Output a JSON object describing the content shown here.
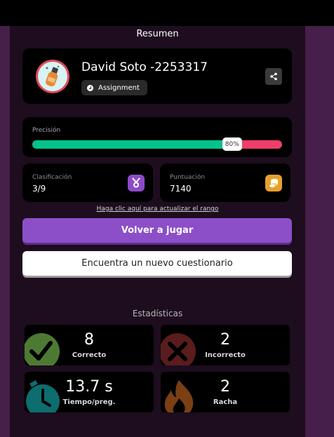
{
  "summary": {
    "title": "Resumen"
  },
  "user": {
    "name": "David Soto -2253317",
    "badge_label": "Assignment"
  },
  "precision": {
    "label": "Precisión",
    "value_text": "80%",
    "fraction": 0.8
  },
  "ranking": {
    "label": "Clasificación",
    "value": "3/9"
  },
  "score": {
    "label": "Puntuación",
    "value": "7140"
  },
  "rank_link": "Haga clic aquí para actualizar el rango",
  "buttons": {
    "play_again": "Volver a jugar",
    "find_quiz": "Encuentra un nuevo cuestionario"
  },
  "stats": {
    "title": "Estadísticas",
    "correct": {
      "value": "8",
      "label": "Correcto"
    },
    "incorrect": {
      "value": "2",
      "label": "Incorrecto"
    },
    "time": {
      "value": "13.7 s",
      "label": "Tiempo/preg."
    },
    "streak": {
      "value": "2",
      "label": "Racha"
    }
  },
  "icons": {
    "share": "share-icon",
    "badge": "clock-icon",
    "ranking": "medal-icon",
    "score": "coins-icon",
    "correct": "check-icon",
    "incorrect": "x-icon",
    "time": "stopwatch-icon",
    "streak": "flame-icon"
  },
  "colors": {
    "accent": "#8c4fc8",
    "correct_bar": "#03c28a",
    "incorrect_bar": "#ef3e68",
    "page_bg": "#1d0d1e",
    "side_bg": "#461f4a"
  }
}
